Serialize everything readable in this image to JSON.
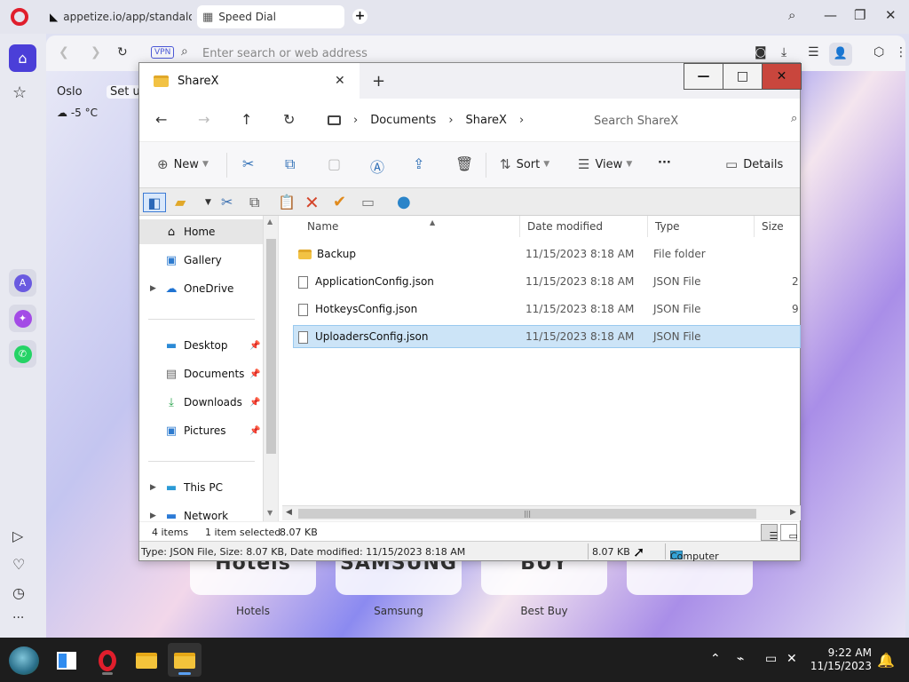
{
  "browser": {
    "tabs": [
      {
        "label": "appetize.io/app/standalo"
      },
      {
        "label": "Speed Dial"
      }
    ],
    "address": {
      "vpn_label": "VPN",
      "placeholder": "Enter search or web address"
    }
  },
  "speed_dial": {
    "weather": {
      "city": "Oslo",
      "setup": "Set up",
      "temp": "-5 °C"
    },
    "tiles": [
      {
        "label": "Hotels",
        "logo_text": "Hotels"
      },
      {
        "label": "Samsung",
        "logo_text": "SAMSUNG"
      },
      {
        "label": "Best Buy",
        "logo_text": "BUY"
      }
    ]
  },
  "explorer": {
    "tab_title": "ShareX",
    "breadcrumb": [
      "Documents",
      "ShareX"
    ],
    "search_placeholder": "Search ShareX",
    "commands": {
      "new": "New",
      "sort": "Sort",
      "view": "View",
      "more": "···",
      "details": "Details"
    },
    "nav_pane": [
      {
        "label": "Home",
        "icon": "home-icon"
      },
      {
        "label": "Gallery",
        "icon": "gallery-icon"
      },
      {
        "label": "OneDrive",
        "icon": "cloud-icon"
      },
      {
        "label": "Desktop",
        "icon": "desktop-icon"
      },
      {
        "label": "Documents",
        "icon": "documents-icon"
      },
      {
        "label": "Downloads",
        "icon": "download-icon"
      },
      {
        "label": "Pictures",
        "icon": "pictures-icon"
      },
      {
        "label": "This PC",
        "icon": "pc-icon"
      },
      {
        "label": "Network",
        "icon": "network-icon"
      }
    ],
    "columns": [
      "Name",
      "Date modified",
      "Type",
      "Size"
    ],
    "files": [
      {
        "name": "Backup",
        "date": "11/15/2023 8:18 AM",
        "type": "File folder",
        "size": ""
      },
      {
        "name": "ApplicationConfig.json",
        "date": "11/15/2023 8:18 AM",
        "type": "JSON File",
        "size": "2"
      },
      {
        "name": "HotkeysConfig.json",
        "date": "11/15/2023 8:18 AM",
        "type": "JSON File",
        "size": "9"
      },
      {
        "name": "UploadersConfig.json",
        "date": "11/15/2023 8:18 AM",
        "type": "JSON File",
        "size": ""
      }
    ],
    "status": {
      "items": "4 items",
      "selected": "1 item selected",
      "selected_size": "8.07 KB"
    },
    "status2": {
      "detail": "Type: JSON File, Size: 8.07 KB, Date modified: 11/15/2023 8:18 AM",
      "size": "8.07 KB",
      "location": "Computer"
    }
  },
  "taskbar": {
    "time": "9:22 AM",
    "date": "11/15/2023"
  },
  "colors": {
    "opera_red": "#e01e2c",
    "opera_accent": "#4b3fd8",
    "selection": "#cce4f7",
    "close_button": "#c9463d"
  }
}
